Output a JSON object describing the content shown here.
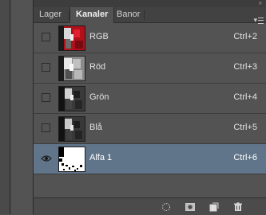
{
  "tabs": [
    {
      "label": "Lager",
      "active": false
    },
    {
      "label": "Kanaler",
      "active": true
    },
    {
      "label": "Banor",
      "active": false
    }
  ],
  "channels": [
    {
      "name": "RGB",
      "shortcut": "Ctrl+2",
      "visible": false,
      "selected": false,
      "thumbnail": "rgb-thumbnail"
    },
    {
      "name": "Röd",
      "shortcut": "Ctrl+3",
      "visible": false,
      "selected": false,
      "thumbnail": "red-channel-thumbnail"
    },
    {
      "name": "Grön",
      "shortcut": "Ctrl+4",
      "visible": false,
      "selected": false,
      "thumbnail": "green-channel-thumbnail"
    },
    {
      "name": "Blå",
      "shortcut": "Ctrl+5",
      "visible": false,
      "selected": false,
      "thumbnail": "blue-channel-thumbnail"
    },
    {
      "name": "Alfa 1",
      "shortcut": "Ctrl+6",
      "visible": true,
      "selected": true,
      "thumbnail": "alpha-channel-thumbnail"
    }
  ],
  "bottom_icons": [
    "load-selection-icon",
    "save-selection-icon",
    "new-channel-icon",
    "delete-channel-icon"
  ],
  "colors": {
    "panel_bg": "#535353",
    "selected_row": "#607589",
    "tab_bar": "#424242"
  }
}
